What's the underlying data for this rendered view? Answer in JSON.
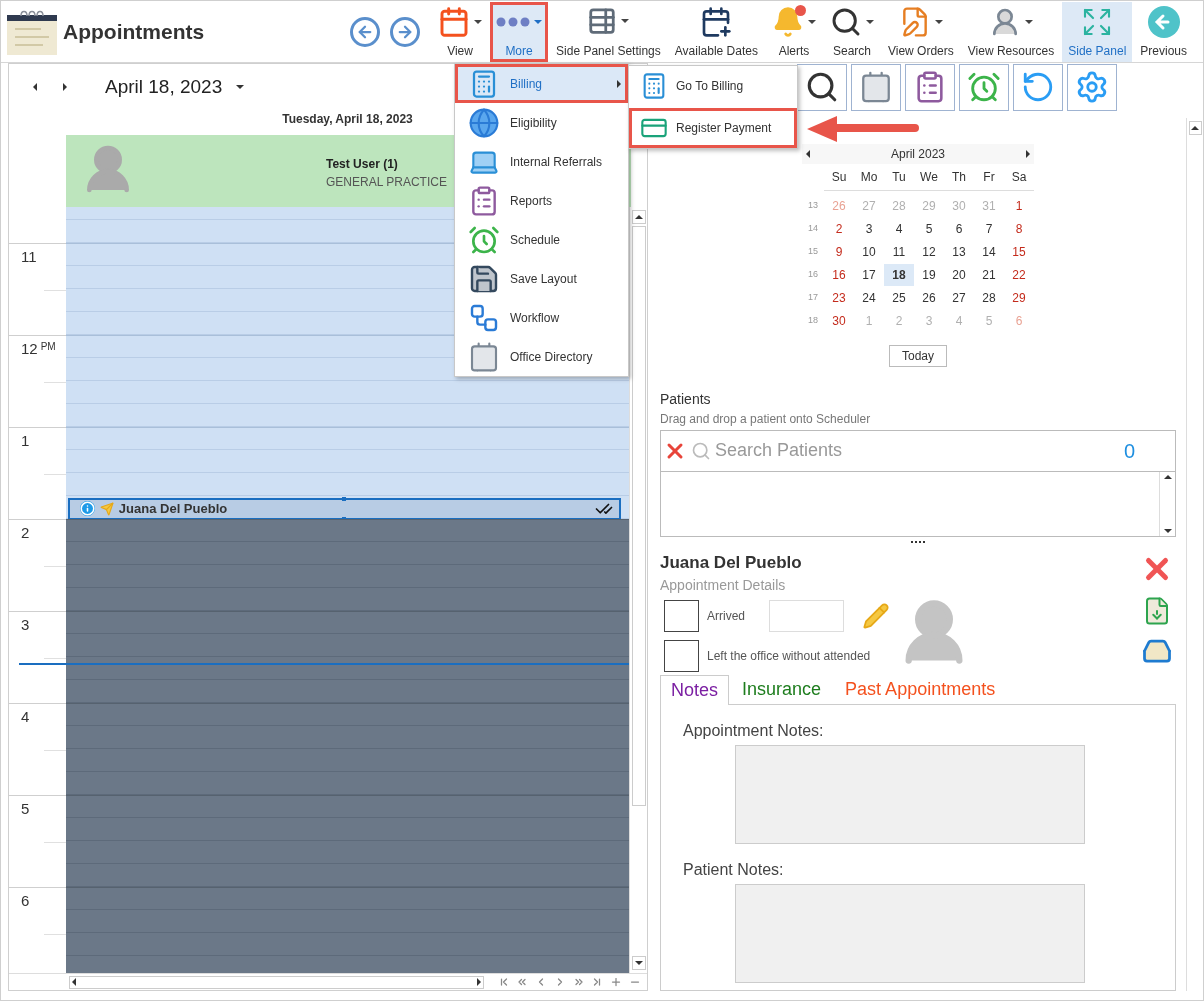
{
  "window": {
    "title": "Appointments"
  },
  "toolbar": [
    {
      "label": "View",
      "selected": false,
      "outlined": false,
      "dropdown": true
    },
    {
      "label": "More",
      "selected": true,
      "outlined": true,
      "dropdown": true
    },
    {
      "label": "Side Panel Settings",
      "selected": false,
      "outlined": false,
      "dropdown": true
    },
    {
      "label": "Available Dates",
      "selected": false,
      "outlined": false,
      "dropdown": false
    },
    {
      "label": "Alerts",
      "selected": false,
      "outlined": false,
      "dropdown": true
    },
    {
      "label": "Search",
      "selected": false,
      "outlined": false,
      "dropdown": true
    },
    {
      "label": "View Orders",
      "selected": false,
      "outlined": false,
      "dropdown": true
    },
    {
      "label": "View Resources",
      "selected": false,
      "outlined": false,
      "dropdown": true
    },
    {
      "label": "Side Panel",
      "selected": true,
      "outlined": false,
      "dropdown": false
    },
    {
      "label": "Previous",
      "selected": false,
      "outlined": false,
      "dropdown": false
    }
  ],
  "more_menu": [
    {
      "label": "Billing",
      "selected": true,
      "outlined": true,
      "submenu": true
    },
    {
      "label": "Eligibility",
      "selected": false,
      "outlined": false,
      "submenu": false
    },
    {
      "label": "Internal Referrals",
      "selected": false,
      "outlined": false,
      "submenu": false
    },
    {
      "label": "Reports",
      "selected": false,
      "outlined": false,
      "submenu": false
    },
    {
      "label": "Schedule",
      "selected": false,
      "outlined": false,
      "submenu": false
    },
    {
      "label": "Save Layout",
      "selected": false,
      "outlined": false,
      "submenu": false
    },
    {
      "label": "Workflow",
      "selected": false,
      "outlined": false,
      "submenu": false
    },
    {
      "label": "Office Directory",
      "selected": false,
      "outlined": false,
      "submenu": false
    }
  ],
  "submenu": [
    {
      "label": "Go To Billing",
      "selected": false,
      "outlined": false
    },
    {
      "label": "Register Payment",
      "selected": false,
      "outlined": true
    }
  ],
  "scheduler": {
    "date": "April 18, 2023",
    "day_header": "Tuesday, April 18, 2023",
    "resource": {
      "name": "Test User (1)",
      "specialty": "GENERAL PRACTICE"
    },
    "hours": [
      {
        "working": true,
        "current_time": false
      },
      {
        "label": "11",
        "working": true,
        "current_time": false
      },
      {
        "label": "12",
        "suffix": "PM",
        "working": true,
        "current_time": false
      },
      {
        "label": "1",
        "working": true,
        "current_time": false,
        "appointments": [
          {
            "patient": "Juana Del Pueblo",
            "selected": true
          }
        ]
      },
      {
        "label": "2",
        "working": false,
        "current_time": false
      },
      {
        "label": "3",
        "working": false,
        "current_time": true
      },
      {
        "label": "4",
        "working": false,
        "current_time": false
      },
      {
        "label": "5",
        "working": false,
        "current_time": false
      },
      {
        "label": "6",
        "working": false,
        "current_time": false
      }
    ]
  },
  "calendar": {
    "month": "April 2023",
    "weekdays": [
      "Su",
      "Mo",
      "Tu",
      "We",
      "Th",
      "Fr",
      "Sa"
    ],
    "weeks": [
      {
        "week": "13",
        "days": [
          {
            "label": "26",
            "other": true,
            "selected": false
          },
          {
            "label": "27",
            "other": true,
            "selected": false
          },
          {
            "label": "28",
            "other": true,
            "selected": false
          },
          {
            "label": "29",
            "other": true,
            "selected": false
          },
          {
            "label": "30",
            "other": true,
            "selected": false
          },
          {
            "label": "31",
            "other": true,
            "selected": false
          },
          {
            "label": "1",
            "other": false,
            "selected": false
          }
        ]
      },
      {
        "week": "14",
        "days": [
          {
            "label": "2",
            "other": false,
            "selected": false
          },
          {
            "label": "3",
            "other": false,
            "selected": false
          },
          {
            "label": "4",
            "other": false,
            "selected": false
          },
          {
            "label": "5",
            "other": false,
            "selected": false
          },
          {
            "label": "6",
            "other": false,
            "selected": false
          },
          {
            "label": "7",
            "other": false,
            "selected": false
          },
          {
            "label": "8",
            "other": false,
            "selected": false
          }
        ]
      },
      {
        "week": "15",
        "days": [
          {
            "label": "9",
            "other": false,
            "selected": false
          },
          {
            "label": "10",
            "other": false,
            "selected": false
          },
          {
            "label": "11",
            "other": false,
            "selected": false
          },
          {
            "label": "12",
            "other": false,
            "selected": false
          },
          {
            "label": "13",
            "other": false,
            "selected": false
          },
          {
            "label": "14",
            "other": false,
            "selected": false
          },
          {
            "label": "15",
            "other": false,
            "selected": false
          }
        ]
      },
      {
        "week": "16",
        "days": [
          {
            "label": "16",
            "other": false,
            "selected": false
          },
          {
            "label": "17",
            "other": false,
            "selected": false
          },
          {
            "label": "18",
            "other": false,
            "selected": true
          },
          {
            "label": "19",
            "other": false,
            "selected": false
          },
          {
            "label": "20",
            "other": false,
            "selected": false
          },
          {
            "label": "21",
            "other": false,
            "selected": false
          },
          {
            "label": "22",
            "other": false,
            "selected": false
          }
        ]
      },
      {
        "week": "17",
        "days": [
          {
            "label": "23",
            "other": false,
            "selected": false
          },
          {
            "label": "24",
            "other": false,
            "selected": false
          },
          {
            "label": "25",
            "other": false,
            "selected": false
          },
          {
            "label": "26",
            "other": false,
            "selected": false
          },
          {
            "label": "27",
            "other": false,
            "selected": false
          },
          {
            "label": "28",
            "other": false,
            "selected": false
          },
          {
            "label": "29",
            "other": false,
            "selected": false
          }
        ]
      },
      {
        "week": "18",
        "days": [
          {
            "label": "30",
            "other": false,
            "selected": false
          },
          {
            "label": "1",
            "other": true,
            "selected": false
          },
          {
            "label": "2",
            "other": true,
            "selected": false
          },
          {
            "label": "3",
            "other": true,
            "selected": false
          },
          {
            "label": "4",
            "other": true,
            "selected": false
          },
          {
            "label": "5",
            "other": true,
            "selected": false
          },
          {
            "label": "6",
            "other": true,
            "selected": false
          }
        ]
      }
    ],
    "today_button": "Today"
  },
  "patients": {
    "title": "Patients",
    "hint": "Drag and drop a patient onto Scheduler",
    "search": {
      "placeholder": "Search Patients"
    },
    "count": "0"
  },
  "details": {
    "patient": "Juana Del Pueblo",
    "subtitle": "Appointment Details",
    "checkboxes": [
      {
        "label": "Arrived",
        "checked": false,
        "kind": "time"
      },
      {
        "label": "Left the office without attended",
        "checked": false,
        "kind": "plain"
      }
    ],
    "tabs": [
      {
        "label": "Notes",
        "selected": true,
        "color": "#7b1fa2"
      },
      {
        "label": "Insurance",
        "selected": false,
        "color": "#1e7d1e"
      },
      {
        "label": "Past Appointments",
        "selected": false,
        "color": "#f4511e"
      }
    ],
    "notes": [
      {
        "label": "Appointment Notes:"
      },
      {
        "label": "Patient Notes:"
      }
    ]
  }
}
